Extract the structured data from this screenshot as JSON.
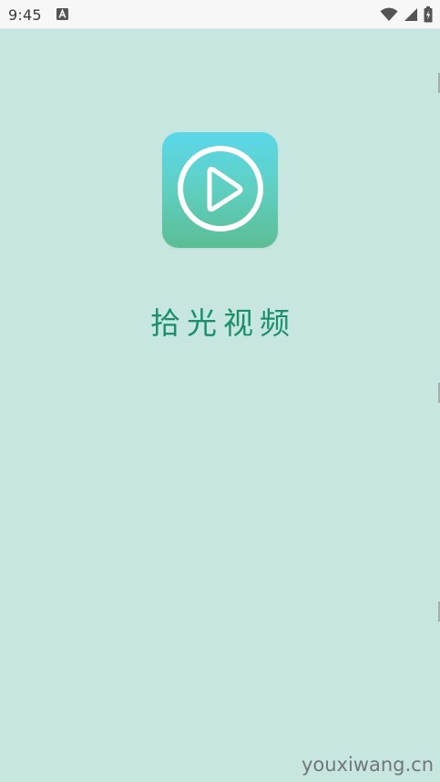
{
  "status_bar": {
    "time": "9:45",
    "notification_icon": "a-letter-icon",
    "right_icons": [
      "wifi-icon",
      "signal-icon",
      "battery-charging-icon"
    ]
  },
  "splash": {
    "app_name": "拾光视频",
    "logo_icon": "play-circle-icon"
  },
  "colors": {
    "background": "#c6e6df",
    "app_name": "#1a9068",
    "logo_gradient_top": "#5ad8ea",
    "logo_gradient_bottom": "#5bbd95"
  },
  "watermark": "youxiwang.cn"
}
